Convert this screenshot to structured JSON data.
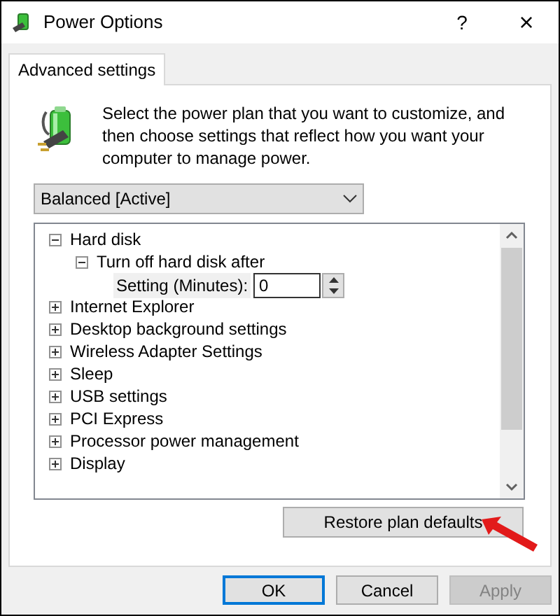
{
  "window": {
    "title": "Power Options",
    "help": "?",
    "close": "×"
  },
  "tabs": [
    {
      "label": "Advanced settings",
      "selected": true
    }
  ],
  "intro": "Select the power plan that you want to customize, and then choose settings that reflect how you want your computer to manage power.",
  "plan_select": {
    "value": "Balanced [Active]"
  },
  "settings_tree": [
    {
      "kind": "group",
      "label": "Hard disk",
      "expanded": true,
      "children": [
        {
          "kind": "group",
          "label": "Turn off hard disk after",
          "expanded": true,
          "children": [
            {
              "kind": "value",
              "label": "Setting (Minutes):",
              "value": "0"
            }
          ]
        }
      ]
    },
    {
      "kind": "group",
      "label": "Internet Explorer",
      "expanded": false
    },
    {
      "kind": "group",
      "label": "Desktop background settings",
      "expanded": false
    },
    {
      "kind": "group",
      "label": "Wireless Adapter Settings",
      "expanded": false
    },
    {
      "kind": "group",
      "label": "Sleep",
      "expanded": false
    },
    {
      "kind": "group",
      "label": "USB settings",
      "expanded": false
    },
    {
      "kind": "group",
      "label": "PCI Express",
      "expanded": false
    },
    {
      "kind": "group",
      "label": "Processor power management",
      "expanded": false
    },
    {
      "kind": "group",
      "label": "Display",
      "expanded": false
    }
  ],
  "restore_button": "Restore plan defaults",
  "buttons": [
    {
      "label": "OK",
      "kind": "default",
      "disabled": false
    },
    {
      "label": "Cancel",
      "kind": "normal",
      "disabled": false
    },
    {
      "label": "Apply",
      "kind": "normal",
      "disabled": true
    }
  ]
}
